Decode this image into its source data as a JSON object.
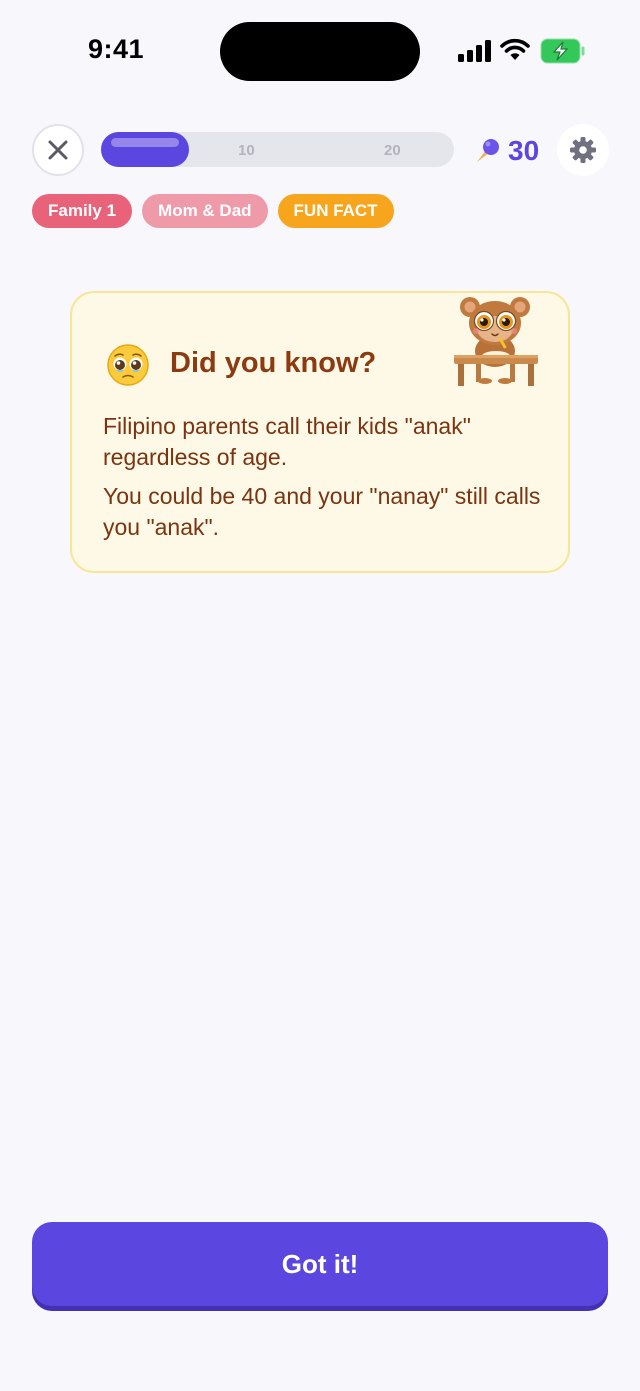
{
  "status_bar": {
    "time": "9:41"
  },
  "lesson_bar": {
    "progress": 0.25,
    "milestones": [
      "10",
      "20"
    ],
    "gems": "30"
  },
  "tags": [
    {
      "label": "Family 1",
      "color": "#e8637a"
    },
    {
      "label": "Mom & Dad",
      "color": "#ef9aa8"
    },
    {
      "label": "FUN FACT",
      "color": "#f7a51c"
    }
  ],
  "fact_card": {
    "emoji": "pleading-face-icon",
    "title": "Did you know?",
    "paragraphs": [
      "Filipino parents call their kids \"anak\" regardless of age.",
      "You could be 40 and your \"nanay\" still calls you \"anak\"."
    ],
    "mascot": "tarsier-at-desk-icon"
  },
  "primary_action": {
    "label": "Got it!"
  },
  "colors": {
    "accent": "#5b46e0",
    "card_bg": "#fef9e6",
    "card_text": "#7a3411"
  }
}
